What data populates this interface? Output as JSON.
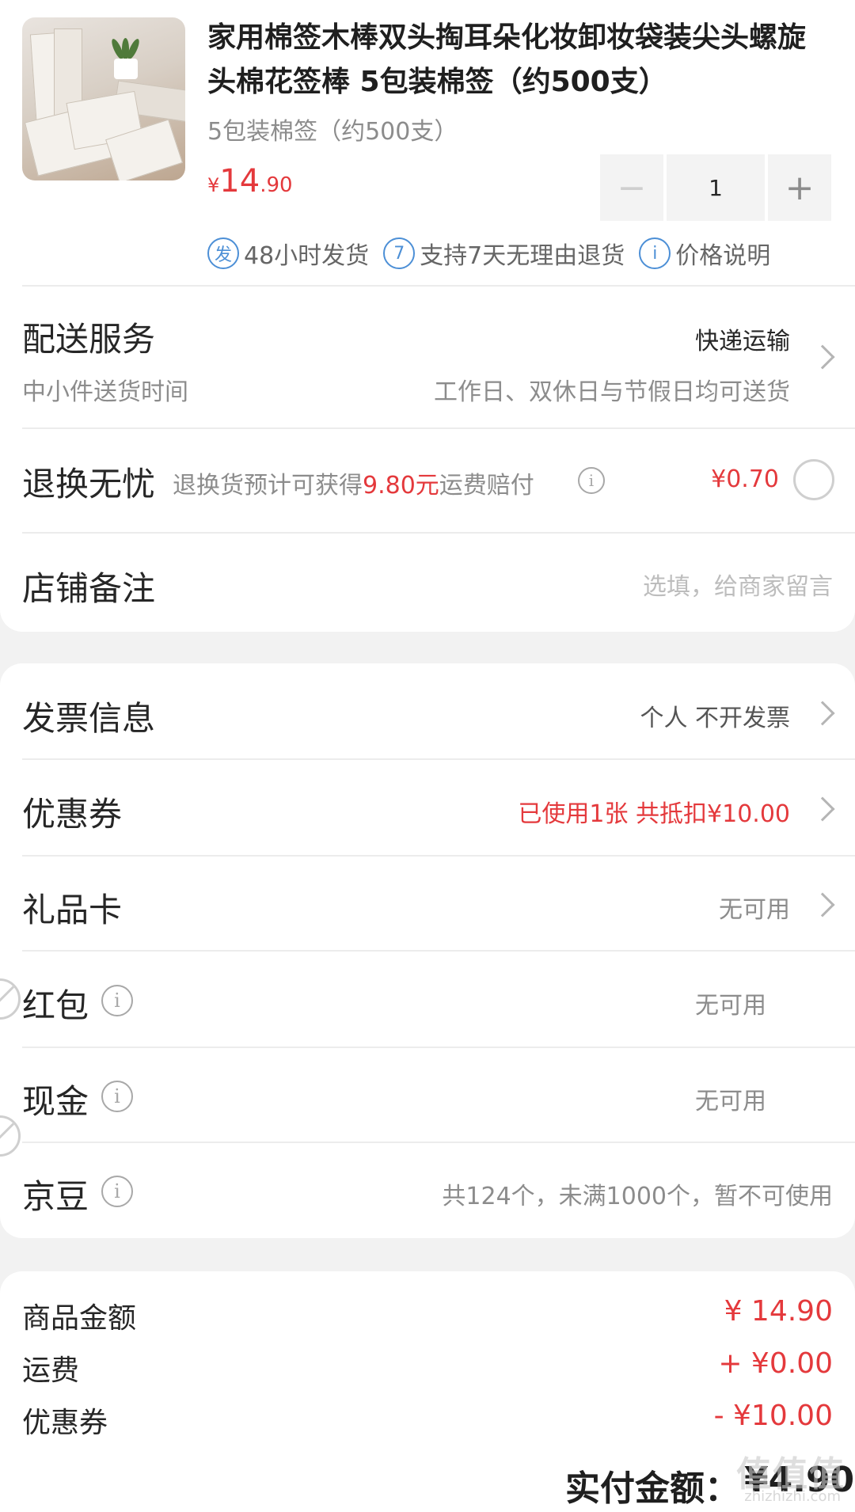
{
  "product": {
    "image_alt": "棉签商品图",
    "title": "家用棉签木棒双头掏耳朵化妆卸妆袋装尖头螺旋头棉花签棒 5包装棉签（约500支）",
    "spec": "5包装棉签（约500支）",
    "price_symbol": "¥",
    "price_int": "14",
    "price_dec": ".90",
    "quantity": "1",
    "badge_ship_icon": "发",
    "badge_ship": "48小时发货",
    "badge_return_icon": "7",
    "badge_return": "支持7天无理由退货",
    "badge_price_icon": "i",
    "badge_price": "价格说明"
  },
  "delivery": {
    "label": "配送服务",
    "method": "快递运输",
    "sub_label": "中小件送货时间",
    "sub_value": "工作日、双休日与节假日均可送货"
  },
  "return": {
    "label": "退换无忧",
    "desc_prefix": "退换货预计可获得",
    "desc_amount": "9.80元",
    "desc_suffix": "运费赔付",
    "price": "¥0.70"
  },
  "note": {
    "label": "店铺备注",
    "placeholder": "选填，给商家留言"
  },
  "invoice": {
    "label": "发票信息",
    "value": "个人 不开发票"
  },
  "coupon": {
    "label": "优惠券",
    "value": "已使用1张 共抵扣¥10.00"
  },
  "giftcard": {
    "label": "礼品卡",
    "value": "无可用"
  },
  "redpacket": {
    "label": "红包",
    "value": "无可用"
  },
  "cash": {
    "label": "现金",
    "value": "无可用"
  },
  "jingdou": {
    "label": "京豆",
    "value": "共124个，未满1000个，暂不可使用"
  },
  "summary": {
    "goods_label": "商品金额",
    "goods_value": "¥ 14.90",
    "freight_label": "运费",
    "freight_value": "+ ¥0.00",
    "coupon_label": "优惠券",
    "coupon_value": "- ¥10.00",
    "total_label": "实付金额：",
    "total_value": "¥4.90"
  },
  "watermark": {
    "main": "值值值",
    "sub": "zhizhizhi.com"
  },
  "colors": {
    "accent": "#e4393c",
    "badge_blue": "#4c8fd6",
    "background": "#f2f2f2"
  },
  "icons": {
    "chevron": "chevron-right-icon",
    "info": "info-icon",
    "radio": "radio-unchecked-icon",
    "unavailable": "unavailable-icon"
  }
}
